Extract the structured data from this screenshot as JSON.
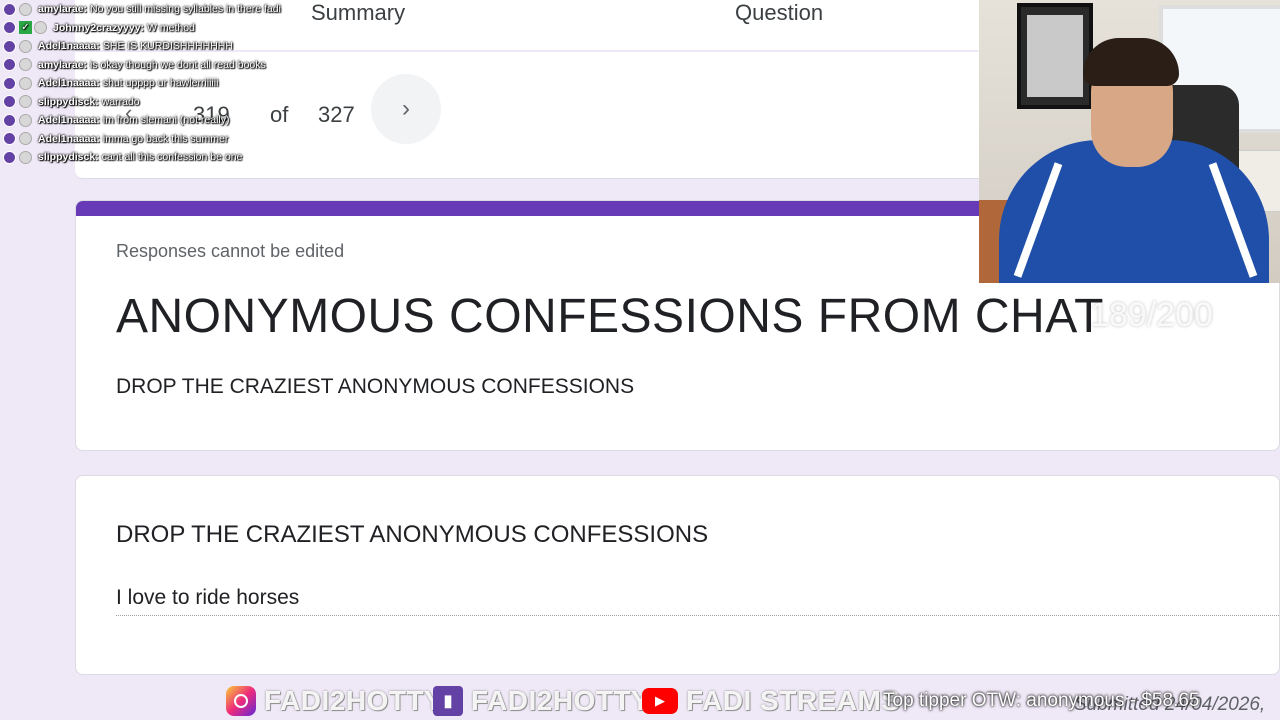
{
  "tabs": {
    "summary": "Summary",
    "question": "Question"
  },
  "navigator": {
    "prev": "‹",
    "current": "319",
    "of": "of",
    "total": "327",
    "next": "›"
  },
  "form": {
    "note": "Responses cannot be edited",
    "title": "ANONYMOUS CONFESSIONS FROM CHAT",
    "description": "DROP THE CRAZIEST ANONYMOUS CONFESSIONS",
    "accent_color": "#673ab7"
  },
  "question": {
    "title": "DROP THE CRAZIEST ANONYMOUS CONFESSIONS",
    "answer": "I love to ride horses"
  },
  "chat": [
    {
      "name": "amylarae:",
      "msg": "No you still missing syllables in there fadi"
    },
    {
      "name": "Johnny2crazyyyy:",
      "msg": "W method"
    },
    {
      "name": "Adel1naaaa:",
      "msg": "SHE IS KURDISHHHHHHH"
    },
    {
      "name": "amylarae:",
      "msg": "is okay though we dont all read books"
    },
    {
      "name": "Adel1naaaa:",
      "msg": "shut upppp ur hawlerriiiiii"
    },
    {
      "name": "slippydisck:",
      "msg": "warrado"
    },
    {
      "name": "Adel1naaaa:",
      "msg": "im from slemani (not really)"
    },
    {
      "name": "Adel1naaaa:",
      "msg": "imma go back this summer"
    },
    {
      "name": "slippydisck:",
      "msg": "cant all this confession be one"
    }
  ],
  "overlay": {
    "counter": "189/200",
    "instagram": "FADI2HOTTY",
    "twitch": "FADI2HOTTY",
    "youtube": "FADI STREAMS",
    "tipper": "Top tipper OTW: anonymous - $58.65",
    "submitted": "Submitted 24/04/2026,"
  }
}
